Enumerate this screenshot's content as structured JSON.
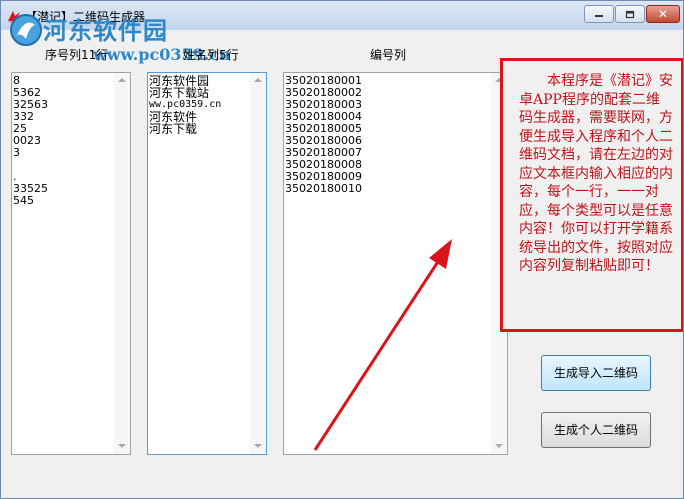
{
  "window": {
    "title": "【潜记】二维码生成器",
    "close_glyph": "✕"
  },
  "watermark": {
    "title": "河东软件园",
    "url": "www.pc0359.cn"
  },
  "columns": {
    "serial_header": "序号列11行",
    "name_header": "姓名列5行",
    "number_header": "编号列"
  },
  "serial_lines": [
    "8",
    "5362",
    "32563",
    "332",
    "25",
    "0023",
    "3",
    "",
    ".",
    "33525",
    "545"
  ],
  "name_lines": [
    "河东软件园",
    "河东下载站",
    "ww.pc0359.cn",
    "河东软件",
    "河东下载"
  ],
  "number_lines": [
    "35020180001",
    "35020180002",
    "35020180003",
    "35020180004",
    "35020180005",
    "35020180006",
    "35020180007",
    "35020180008",
    "35020180009",
    "35020180010"
  ],
  "info": {
    "text": "本程序是《潜记》安卓APP程序的配套二维码生成器，需要联网，方便生成导入程序和个人二维码文档，请在左边的对应文本框内输入相应的内容，每个一行，一一对应，每个类型可以是任意内容！你可以打开学籍系统导出的文件，按照对应内容列复制粘贴即可！"
  },
  "buttons": {
    "generate_import": "生成导入二维码",
    "generate_personal": "生成个人二维码"
  },
  "colors": {
    "annotation_red": "#d9141a",
    "watermark_blue": "#2c86c8"
  }
}
